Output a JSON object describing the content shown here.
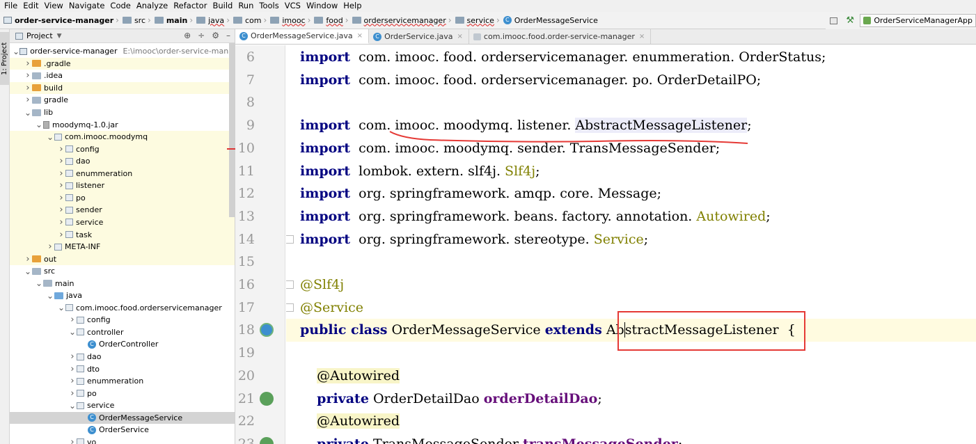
{
  "menu": [
    "File",
    "Edit",
    "View",
    "Navigate",
    "Code",
    "Analyze",
    "Refactor",
    "Build",
    "Run",
    "Tools",
    "VCS",
    "Window",
    "Help"
  ],
  "breadcrumb": {
    "project": "order-service-manager",
    "items": [
      "src",
      "main",
      "java",
      "com",
      "imooc",
      "food",
      "orderservicemanager",
      "service"
    ],
    "file": "OrderMessageService"
  },
  "run_config": "OrderServiceManagerApp",
  "side_tab": "1: Project",
  "project_panel": {
    "title": "Project",
    "tree": [
      {
        "label": "order-service-manager",
        "path": "E:\\imooc\\order-service-manager",
        "depth": 0,
        "arrow": "open",
        "icon": "mod",
        "hl": false
      },
      {
        "label": ".gradle",
        "depth": 1,
        "arrow": "closed",
        "icon": "yfolder",
        "hl": true
      },
      {
        "label": ".idea",
        "depth": 1,
        "arrow": "closed",
        "icon": "folder",
        "hl": false
      },
      {
        "label": "build",
        "depth": 1,
        "arrow": "closed",
        "icon": "yfolder",
        "hl": true
      },
      {
        "label": "gradle",
        "depth": 1,
        "arrow": "closed",
        "icon": "folder",
        "hl": false
      },
      {
        "label": "lib",
        "depth": 1,
        "arrow": "open",
        "icon": "folder",
        "hl": false
      },
      {
        "label": "moodymq-1.0.jar",
        "depth": 2,
        "arrow": "open",
        "icon": "jar",
        "hl": false
      },
      {
        "label": "com.imooc.moodymq",
        "depth": 3,
        "arrow": "open",
        "icon": "pkg",
        "hl": true
      },
      {
        "label": "config",
        "depth": 4,
        "arrow": "closed",
        "icon": "pkg",
        "hl": true
      },
      {
        "label": "dao",
        "depth": 4,
        "arrow": "closed",
        "icon": "pkg",
        "hl": true
      },
      {
        "label": "enummeration",
        "depth": 4,
        "arrow": "closed",
        "icon": "pkg",
        "hl": true
      },
      {
        "label": "listener",
        "depth": 4,
        "arrow": "closed",
        "icon": "pkg",
        "hl": true
      },
      {
        "label": "po",
        "depth": 4,
        "arrow": "closed",
        "icon": "pkg",
        "hl": true
      },
      {
        "label": "sender",
        "depth": 4,
        "arrow": "closed",
        "icon": "pkg",
        "hl": true
      },
      {
        "label": "service",
        "depth": 4,
        "arrow": "closed",
        "icon": "pkg",
        "hl": true
      },
      {
        "label": "task",
        "depth": 4,
        "arrow": "closed",
        "icon": "pkg",
        "hl": true
      },
      {
        "label": "META-INF",
        "depth": 3,
        "arrow": "closed",
        "icon": "pkg",
        "hl": true
      },
      {
        "label": "out",
        "depth": 1,
        "arrow": "closed",
        "icon": "yfolder",
        "hl": true
      },
      {
        "label": "src",
        "depth": 1,
        "arrow": "open",
        "icon": "folder",
        "hl": false
      },
      {
        "label": "main",
        "depth": 2,
        "arrow": "open",
        "icon": "folder",
        "hl": false
      },
      {
        "label": "java",
        "depth": 3,
        "arrow": "open",
        "icon": "bfolder",
        "hl": false
      },
      {
        "label": "com.imooc.food.orderservicemanager",
        "depth": 4,
        "arrow": "open",
        "icon": "pkg",
        "hl": false
      },
      {
        "label": "config",
        "depth": 5,
        "arrow": "closed",
        "icon": "pkg",
        "hl": false
      },
      {
        "label": "controller",
        "depth": 5,
        "arrow": "open",
        "icon": "pkg",
        "hl": false
      },
      {
        "label": "OrderController",
        "depth": 6,
        "arrow": "none",
        "icon": "cls",
        "hl": false
      },
      {
        "label": "dao",
        "depth": 5,
        "arrow": "closed",
        "icon": "pkg",
        "hl": false
      },
      {
        "label": "dto",
        "depth": 5,
        "arrow": "closed",
        "icon": "pkg",
        "hl": false
      },
      {
        "label": "enummeration",
        "depth": 5,
        "arrow": "closed",
        "icon": "pkg",
        "hl": false
      },
      {
        "label": "po",
        "depth": 5,
        "arrow": "closed",
        "icon": "pkg",
        "hl": false
      },
      {
        "label": "service",
        "depth": 5,
        "arrow": "open",
        "icon": "pkg",
        "hl": false
      },
      {
        "label": "OrderMessageService",
        "depth": 6,
        "arrow": "none",
        "icon": "cls",
        "hl": false,
        "selected": true
      },
      {
        "label": "OrderService",
        "depth": 6,
        "arrow": "none",
        "icon": "cls",
        "hl": false
      },
      {
        "label": "vo",
        "depth": 5,
        "arrow": "closed",
        "icon": "pkg",
        "hl": false
      }
    ]
  },
  "tabs": [
    {
      "label": "OrderMessageService.java",
      "active": true,
      "icon": "cls"
    },
    {
      "label": "OrderService.java",
      "active": false,
      "icon": "cls"
    },
    {
      "label": "com.imooc.food.order-service-manager",
      "active": false,
      "icon": "gradle"
    }
  ],
  "code_lines": [
    {
      "n": 6,
      "segs": [
        [
          "kw",
          "import"
        ],
        [
          "",
          "  com. imooc. food. orderservicemanager. enummeration. OrderStatus;"
        ]
      ]
    },
    {
      "n": 7,
      "segs": [
        [
          "kw",
          "import"
        ],
        [
          "",
          "  com. imooc. food. orderservicemanager. po. OrderDetailPO;"
        ]
      ]
    },
    {
      "n": 8,
      "segs": []
    },
    {
      "n": 9,
      "segs": [
        [
          "kw",
          "import"
        ],
        [
          "",
          "  com. imooc. moodymq. listener. "
        ],
        [
          "ident",
          "AbstractMessageListener"
        ],
        [
          "",
          ";"
        ]
      ]
    },
    {
      "n": 10,
      "segs": [
        [
          "kw",
          "import"
        ],
        [
          "",
          "  com. imooc. moodymq. sender. TransMessageSender;"
        ]
      ]
    },
    {
      "n": 11,
      "segs": [
        [
          "kw",
          "import"
        ],
        [
          "",
          "  lombok. extern. slf4j. "
        ],
        [
          "ann",
          "Slf4j"
        ],
        [
          "",
          ";"
        ]
      ]
    },
    {
      "n": 12,
      "segs": [
        [
          "kw",
          "import"
        ],
        [
          "",
          "  org. springframework. amqp. core. Message;"
        ]
      ]
    },
    {
      "n": 13,
      "segs": [
        [
          "kw",
          "import"
        ],
        [
          "",
          "  org. springframework. beans. factory. annotation. "
        ],
        [
          "ann",
          "Autowired"
        ],
        [
          "",
          ";"
        ]
      ]
    },
    {
      "n": 14,
      "segs": [
        [
          "kw",
          "import"
        ],
        [
          "",
          "  org. springframework. stereotype. "
        ],
        [
          "ann",
          "Service"
        ],
        [
          "",
          ";"
        ]
      ]
    },
    {
      "n": 15,
      "segs": []
    },
    {
      "n": 16,
      "segs": [
        [
          "ann",
          "@Slf4j"
        ]
      ]
    },
    {
      "n": 17,
      "segs": [
        [
          "ann",
          "@Service"
        ]
      ]
    },
    {
      "n": 18,
      "cur": true,
      "segs": [
        [
          "kw",
          "public class"
        ],
        [
          "",
          " OrderMessageService "
        ],
        [
          "kw",
          "extends"
        ],
        [
          "",
          " Ab"
        ],
        [
          "caret",
          ""
        ],
        [
          "",
          "stractMessageListener  {"
        ]
      ]
    },
    {
      "n": 19,
      "segs": []
    },
    {
      "n": 20,
      "segs": [
        [
          "",
          "    "
        ],
        [
          "annhl",
          "@Autowired"
        ]
      ]
    },
    {
      "n": 21,
      "segs": [
        [
          "",
          "    "
        ],
        [
          "kw",
          "private"
        ],
        [
          "",
          " OrderDetailDao "
        ],
        [
          "fld",
          "orderDetailDao"
        ],
        [
          "",
          ";"
        ]
      ]
    },
    {
      "n": 22,
      "segs": [
        [
          "",
          "    "
        ],
        [
          "annhl",
          "@Autowired"
        ]
      ]
    },
    {
      "n": 23,
      "segs": [
        [
          "",
          "    "
        ],
        [
          "kw",
          "private"
        ],
        [
          "",
          " TransMessageSender "
        ],
        [
          "fld",
          "transMessageSender"
        ],
        [
          "",
          ";"
        ]
      ]
    }
  ],
  "colors": {
    "keyword": "#000080",
    "annotation": "#808000",
    "field": "#660e7a",
    "highlight_box": "#e53935",
    "underline": "#e53935"
  }
}
